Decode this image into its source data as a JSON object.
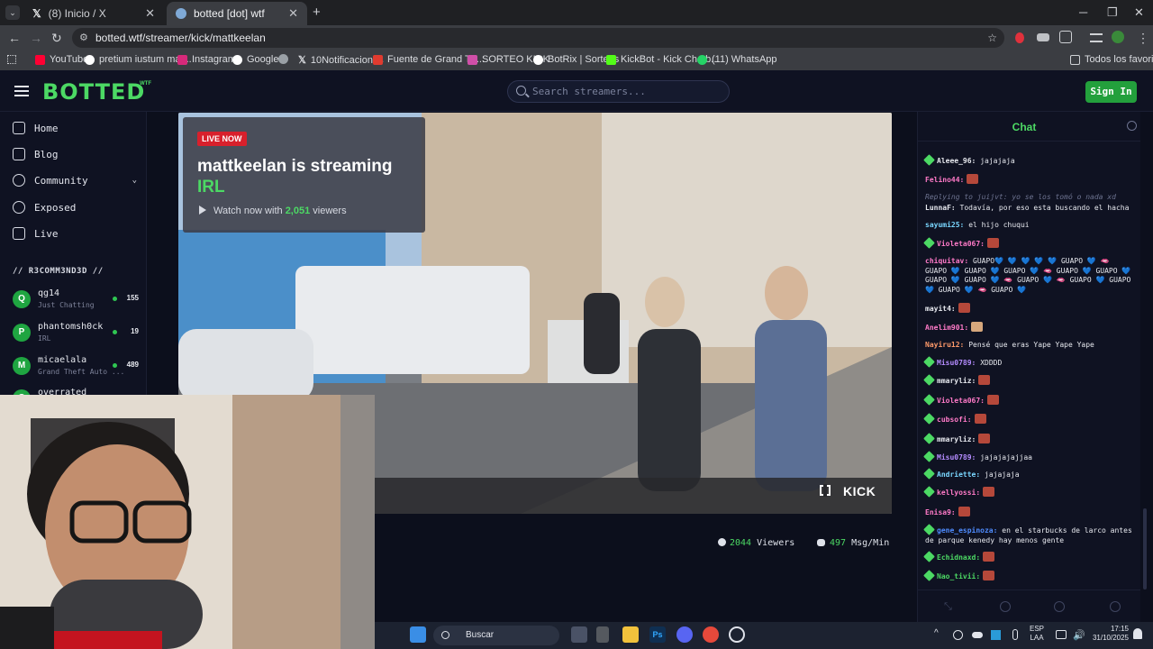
{
  "browser": {
    "tabs": [
      {
        "label": "(8) Inicio / X",
        "active": false
      },
      {
        "label": "botted [dot] wtf",
        "active": true
      }
    ],
    "url": "botted.wtf/streamer/kick/mattkeelan",
    "bookmarks": [
      {
        "label": "YouTube",
        "color": "#ff0033"
      },
      {
        "label": "pretium iustum mat...",
        "color": "#ffffff"
      },
      {
        "label": "Instagram",
        "color": "#d6297a"
      },
      {
        "label": "Google",
        "color": "#ffffff"
      },
      {
        "label": "",
        "color": "#9aa0a6"
      },
      {
        "label": "10Notificaciones",
        "color": "#e7e9ea"
      },
      {
        "label": "Fuente de Grand Th...",
        "color": "#e03b2f"
      },
      {
        "label": "SORTEO KICK",
        "color": "#d04fa8"
      },
      {
        "label": "BotRix | Sorteos",
        "color": "#ffffff"
      },
      {
        "label": "KickBot - Kick Chatb...",
        "color": "#53fc18"
      },
      {
        "label": "(11) WhatsApp",
        "color": "#25d366"
      }
    ],
    "all_favorites": "Todos los favoritos"
  },
  "site": {
    "logo": "BOTTED",
    "logo_sup": "WTF",
    "search_placeholder": "Search streamers...",
    "signin": "Sign In",
    "accent": "#4cd964"
  },
  "sidebar": {
    "nav": [
      {
        "label": "Home",
        "icon": "home-icon"
      },
      {
        "label": "Blog",
        "icon": "blog-icon"
      },
      {
        "label": "Community",
        "icon": "community-icon"
      },
      {
        "label": "Exposed",
        "icon": "eye-icon"
      },
      {
        "label": "Live",
        "icon": "tv-icon"
      }
    ],
    "rec_heading": "// R3COMM3ND3D //",
    "recommended": [
      {
        "initial": "Q",
        "name": "qg14",
        "category": "Just Chatting",
        "viewers": "155"
      },
      {
        "initial": "P",
        "name": "phantomsh0ck",
        "category": "IRL",
        "viewers": "19"
      },
      {
        "initial": "M",
        "name": "micaelala",
        "category": "Grand Theft Auto ...",
        "viewers": "489"
      },
      {
        "initial": "O",
        "name": "overrated",
        "category": "",
        "viewers": ""
      }
    ]
  },
  "stream": {
    "live_badge": "LIVE NOW",
    "title_line1": "mattkeelan is streaming",
    "category": "IRL",
    "watch_prefix": "Watch now with",
    "watch_count": "2,051",
    "watch_suffix": "viewers",
    "kick": "KICK",
    "viewers_num": "2044",
    "viewers_label": "Viewers",
    "msg_num": "497",
    "msg_label": "Msg/Min"
  },
  "chat": {
    "title": "Chat",
    "messages": [
      {
        "user": "Aleee_96:",
        "text": "jajajaja",
        "color": "#e7e9ef",
        "badge": true,
        "emote": false
      },
      {
        "user": "Felino44:",
        "text": "",
        "color": "#ff7ac8",
        "badge": false,
        "emote": true
      },
      {
        "reply": "Replying to juijvt: yo se los tomó o nada xd"
      },
      {
        "user": "LunnaF:",
        "text": "Todavía, por eso esta buscando el hacha",
        "color": "#e7e9ef",
        "badge": false,
        "emote": false
      },
      {
        "user": "sayumi25:",
        "text": "el hijo chuqui",
        "color": "#7ad7ff",
        "badge": false,
        "emote": false
      },
      {
        "user": "Violeta067:",
        "text": "",
        "color": "#ff7ac8",
        "badge": true,
        "emote": true
      },
      {
        "user": "chiquitav:",
        "text": "GUAPO💙 💙 💙 💙 💙 GUAPO 💙 🫦 GUAPO 💙 GUAPO 💙 GUAPO 💙 🫦 GUAPO 💙 GUAPO 💙 GUAPO 💙 GUAPO 💙 🫦 GUAPO 💙 🫦 GUAPO 💙 GUAPO 💙 GUAPO 💙 🫦 GUAPO 💙",
        "color": "#ff7ac8",
        "badge": false,
        "emote": false
      },
      {
        "user": "mayit4:",
        "text": "",
        "color": "#e7e9ef",
        "badge": false,
        "emote": true
      },
      {
        "user": "Anelim901:",
        "text": "",
        "color": "#ff7ac8",
        "badge": false,
        "emote": true
      },
      {
        "user": "Nayiru12:",
        "text": "Pensé que eras Yape Yape Yape",
        "color": "#ff9a6a",
        "badge": false,
        "emote": false
      },
      {
        "user": "Misu0789:",
        "text": "XDDDD",
        "color": "#b48cff",
        "badge": true,
        "emote": false
      },
      {
        "user": "mmaryliz:",
        "text": "",
        "color": "#e7e9ef",
        "badge": true,
        "emote": true
      },
      {
        "user": "Violeta067:",
        "text": "",
        "color": "#ff7ac8",
        "badge": true,
        "emote": true
      },
      {
        "user": "cubsofi:",
        "text": "",
        "color": "#ff7ac8",
        "badge": true,
        "emote": true
      },
      {
        "user": "mmaryliz:",
        "text": "",
        "color": "#e7e9ef",
        "badge": true,
        "emote": true
      },
      {
        "user": "Misu0789:",
        "text": "jajajajajjaa",
        "color": "#b48cff",
        "badge": true,
        "emote": false
      },
      {
        "user": "Andriette:",
        "text": "jajajaja",
        "color": "#7ad7ff",
        "badge": true,
        "emote": false
      },
      {
        "user": "kellyossi:",
        "text": "",
        "color": "#ff7ac8",
        "badge": true,
        "emote": true
      },
      {
        "user": "Enisa9:",
        "text": "",
        "color": "#ff7ac8",
        "badge": false,
        "emote": true
      },
      {
        "user": "gene_espinoza:",
        "text": "en el starbucks de larco antes de parque kenedy hay menos gente",
        "color": "#4f8cff",
        "badge": true,
        "emote": false
      },
      {
        "user": "Echidnaxd:",
        "text": "",
        "color": "#4cd964",
        "badge": true,
        "emote": true
      },
      {
        "user": "Nao_tivii:",
        "text": "",
        "color": "#4cd964",
        "badge": true,
        "emote": true
      }
    ]
  },
  "taskbar": {
    "search": "Buscar",
    "lang1": "ESP",
    "lang2": "LAA",
    "time": "17:15",
    "date": "31/10/2025"
  }
}
